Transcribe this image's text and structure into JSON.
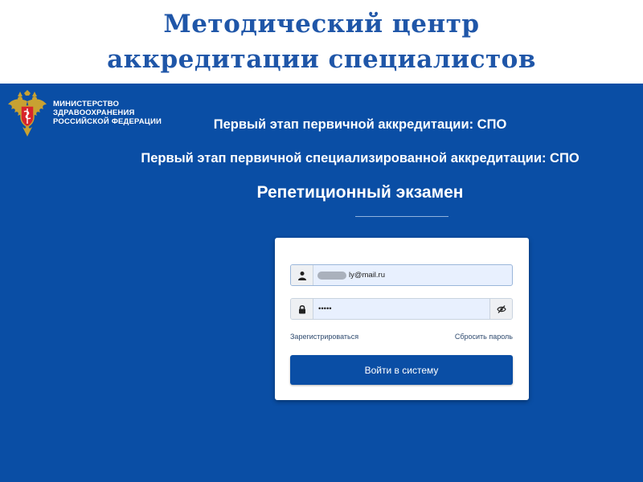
{
  "slide": {
    "title_line1": "Методический центр",
    "title_line2": "аккредитации специалистов"
  },
  "ministry": {
    "logo_icon": "double-headed-eagle-emblem",
    "name_line1": "МИНИСТЕРСТВО",
    "name_line2": "ЗДРАВООХРАНЕНИЯ",
    "name_line3": "РОССИЙСКОЙ ФЕДЕРАЦИИ"
  },
  "headings": {
    "stage1": "Первый этап первичной аккредитации: СПО",
    "stage1_specialized": "Первый этап первичной специализированной аккредитации: СПО",
    "exam": "Репетиционный экзамен"
  },
  "login_form": {
    "login_icon": "user-icon",
    "login_value": "ly@mail.ru",
    "password_icon": "lock-icon",
    "password_value": "•••••",
    "toggle_icon": "eye-slash-icon",
    "register_link": "Зарегистрироваться",
    "reset_link": "Сбросить пароль",
    "submit_label": "Войти в систему"
  },
  "colors": {
    "title": "#1f56a8",
    "background": "#0a4ea5",
    "button": "#0a4ea5",
    "input_fill": "#e8f0fe"
  }
}
